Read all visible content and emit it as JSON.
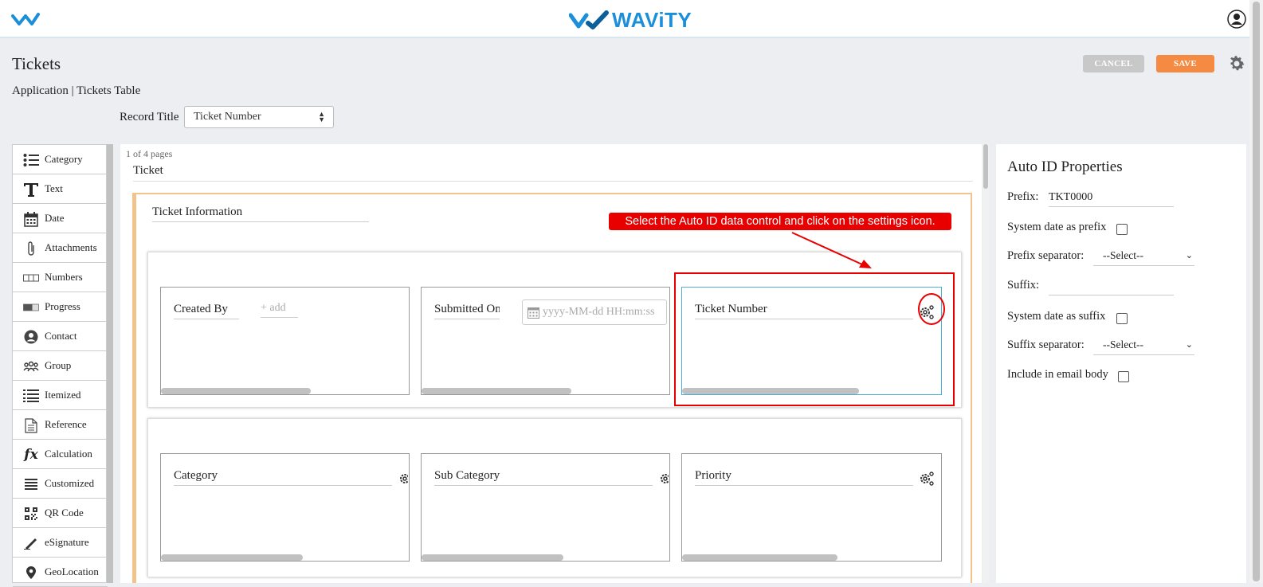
{
  "app": {
    "brand": "WAViTY"
  },
  "header": {
    "title": "Tickets",
    "breadcrumb": "Application | Tickets Table"
  },
  "toolbar": {
    "cancel_label": "CANCEL",
    "save_label": "SAVE"
  },
  "record_title": {
    "label": "Record Title",
    "value": "Ticket Number"
  },
  "palette": {
    "items": [
      {
        "label": "Category",
        "icon": "list-icon"
      },
      {
        "label": "Text",
        "icon": "text-icon"
      },
      {
        "label": "Date",
        "icon": "calendar-icon"
      },
      {
        "label": "Attachments",
        "icon": "paperclip-icon"
      },
      {
        "label": "Numbers",
        "icon": "numbers-icon"
      },
      {
        "label": "Progress",
        "icon": "progress-icon"
      },
      {
        "label": "Contact",
        "icon": "contact-icon"
      },
      {
        "label": "Group",
        "icon": "group-icon"
      },
      {
        "label": "Itemized",
        "icon": "itemized-icon"
      },
      {
        "label": "Reference",
        "icon": "document-icon"
      },
      {
        "label": "Calculation",
        "icon": "fx-icon"
      },
      {
        "label": "Customized",
        "icon": "lines-icon"
      },
      {
        "label": "QR Code",
        "icon": "qr-code-icon"
      },
      {
        "label": "eSignature",
        "icon": "pen-icon"
      },
      {
        "label": "GeoLocation",
        "icon": "location-pin-icon"
      }
    ]
  },
  "canvas": {
    "pages": "1 of 4 pages",
    "form_title": "Ticket",
    "section_title": "Ticket Information",
    "row1": {
      "created_by": "Created By",
      "add_placeholder": "+ add",
      "submitted_on": "Submitted On",
      "date_placeholder": "yyyy-MM-dd HH:mm:ss",
      "ticket_number": "Ticket Number"
    },
    "row2": {
      "category": "Category",
      "sub_category": "Sub Category",
      "priority": "Priority"
    }
  },
  "annotation": {
    "callout": "Select the Auto ID data control and click on the settings icon.",
    "color": "#e80000"
  },
  "properties": {
    "title": "Auto ID Properties",
    "prefix_label": "Prefix:",
    "prefix_value": "TKT0000",
    "system_date_prefix_label": "System date as prefix",
    "prefix_separator_label": "Prefix separator:",
    "prefix_separator_value": "--Select--",
    "suffix_label": "Suffix:",
    "suffix_value": "",
    "system_date_suffix_label": "System date as suffix",
    "suffix_separator_label": "Suffix separator:",
    "suffix_separator_value": "--Select--",
    "include_email_label": "Include in email body"
  },
  "colors": {
    "brand": "#1b8fd9",
    "save": "#f58a42",
    "cancel": "#c8c8c8",
    "section_border": "#f3c38c"
  }
}
